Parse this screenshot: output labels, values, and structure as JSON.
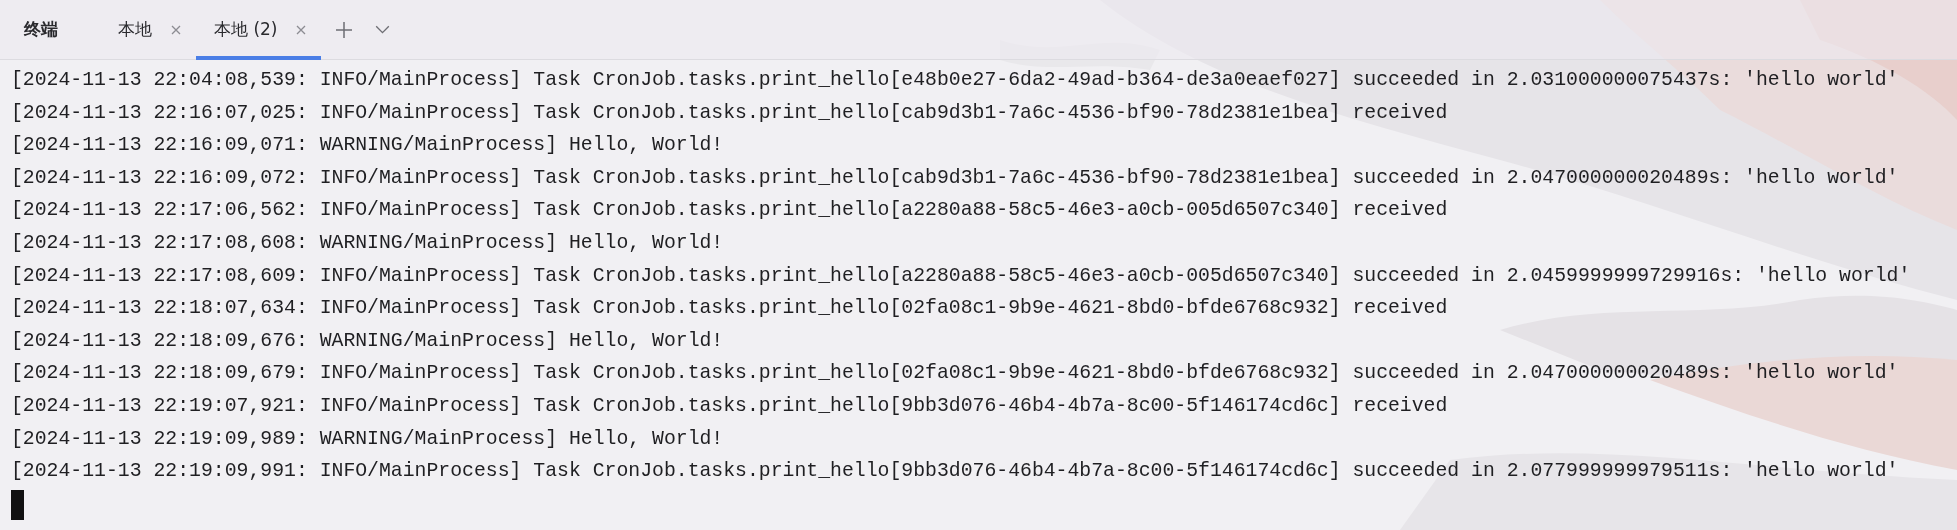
{
  "panel_title": "终端",
  "tabs": [
    {
      "label": "本地",
      "selected": false
    },
    {
      "label": "本地 (2)",
      "selected": true
    }
  ],
  "lines": [
    "[2024-11-13 22:04:08,539: INFO/MainProcess] Task CronJob.tasks.print_hello[e48b0e27-6da2-49ad-b364-de3a0eaef027] succeeded in 2.031000000075437s: 'hello world'",
    "[2024-11-13 22:16:07,025: INFO/MainProcess] Task CronJob.tasks.print_hello[cab9d3b1-7a6c-4536-bf90-78d2381e1bea] received",
    "[2024-11-13 22:16:09,071: WARNING/MainProcess] Hello, World!",
    "[2024-11-13 22:16:09,072: INFO/MainProcess] Task CronJob.tasks.print_hello[cab9d3b1-7a6c-4536-bf90-78d2381e1bea] succeeded in 2.047000000020489s: 'hello world'",
    "[2024-11-13 22:17:06,562: INFO/MainProcess] Task CronJob.tasks.print_hello[a2280a88-58c5-46e3-a0cb-005d6507c340] received",
    "[2024-11-13 22:17:08,608: WARNING/MainProcess] Hello, World!",
    "[2024-11-13 22:17:08,609: INFO/MainProcess] Task CronJob.tasks.print_hello[a2280a88-58c5-46e3-a0cb-005d6507c340] succeeded in 2.0459999999729916s: 'hello world'",
    "[2024-11-13 22:18:07,634: INFO/MainProcess] Task CronJob.tasks.print_hello[02fa08c1-9b9e-4621-8bd0-bfde6768c932] received",
    "[2024-11-13 22:18:09,676: WARNING/MainProcess] Hello, World!",
    "[2024-11-13 22:18:09,679: INFO/MainProcess] Task CronJob.tasks.print_hello[02fa08c1-9b9e-4621-8bd0-bfde6768c932] succeeded in 2.047000000020489s: 'hello world'",
    "[2024-11-13 22:19:07,921: INFO/MainProcess] Task CronJob.tasks.print_hello[9bb3d076-46b4-4b7a-8c00-5f146174cd6c] received",
    "[2024-11-13 22:19:09,989: WARNING/MainProcess] Hello, World!",
    "[2024-11-13 22:19:09,991: INFO/MainProcess] Task CronJob.tasks.print_hello[9bb3d076-46b4-4b7a-8c00-5f146174cd6c] succeeded in 2.077999999979511s: 'hello world'"
  ]
}
